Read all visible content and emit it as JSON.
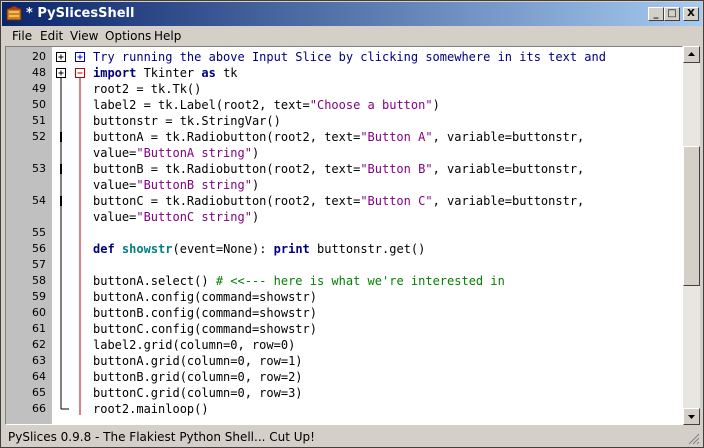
{
  "window": {
    "title": "* PySlicesShell",
    "icon": "pyslices-app-icon"
  },
  "title_buttons": {
    "minimize": "_",
    "maximize": "□",
    "close": "X"
  },
  "menu": [
    "File",
    "Edit",
    "View",
    "Options",
    "Help"
  ],
  "editor": {
    "lines": [
      {
        "num": "20",
        "fold": "plus-both",
        "tokens": [
          {
            "t": "Try running the above Input Slice by clicking somewhere in its text and",
            "c": "kw-plain"
          }
        ]
      },
      {
        "num": "48",
        "fold": "plus-minus",
        "tokens": [
          {
            "t": "import",
            "c": "kw"
          },
          {
            "t": " Tkinter ",
            "c": "plain"
          },
          {
            "t": "as",
            "c": "kw"
          },
          {
            "t": " tk",
            "c": "plain"
          }
        ]
      },
      {
        "num": "49",
        "fold": "",
        "tokens": [
          {
            "t": "root2 = tk.Tk()",
            "c": "plain"
          }
        ]
      },
      {
        "num": "50",
        "fold": "",
        "tokens": [
          {
            "t": "label2 = tk.Label(root2, text=",
            "c": "plain"
          },
          {
            "t": "\"Choose a button\"",
            "c": "str"
          },
          {
            "t": ")",
            "c": "plain"
          }
        ]
      },
      {
        "num": "51",
        "fold": "",
        "tokens": [
          {
            "t": "buttonstr = tk.StringVar()",
            "c": "plain"
          }
        ]
      },
      {
        "num": "52",
        "fold": "",
        "tokens": [
          {
            "t": "buttonA = tk.Radiobutton(root2, text=",
            "c": "plain"
          },
          {
            "t": "\"Button A\"",
            "c": "str"
          },
          {
            "t": ", variable=buttonstr,",
            "c": "plain"
          }
        ]
      },
      {
        "num": "",
        "fold": "",
        "tokens": [
          {
            "t": "value=",
            "c": "plain"
          },
          {
            "t": "\"ButtonA string\"",
            "c": "str"
          },
          {
            "t": ")",
            "c": "plain"
          }
        ]
      },
      {
        "num": "53",
        "fold": "",
        "tokens": [
          {
            "t": "buttonB = tk.Radiobutton(root2, text=",
            "c": "plain"
          },
          {
            "t": "\"Button B\"",
            "c": "str"
          },
          {
            "t": ", variable=buttonstr,",
            "c": "plain"
          }
        ]
      },
      {
        "num": "",
        "fold": "",
        "tokens": [
          {
            "t": "value=",
            "c": "plain"
          },
          {
            "t": "\"ButtonB string\"",
            "c": "str"
          },
          {
            "t": ")",
            "c": "plain"
          }
        ]
      },
      {
        "num": "54",
        "fold": "",
        "tokens": [
          {
            "t": "buttonC = tk.Radiobutton(root2, text=",
            "c": "plain"
          },
          {
            "t": "\"Button C\"",
            "c": "str"
          },
          {
            "t": ", variable=buttonstr,",
            "c": "plain"
          }
        ]
      },
      {
        "num": "",
        "fold": "",
        "tokens": [
          {
            "t": "value=",
            "c": "plain"
          },
          {
            "t": "\"ButtonC string\"",
            "c": "str"
          },
          {
            "t": ")",
            "c": "plain"
          }
        ]
      },
      {
        "num": "55",
        "fold": "",
        "tokens": []
      },
      {
        "num": "56",
        "fold": "",
        "tokens": [
          {
            "t": "def",
            "c": "kw"
          },
          {
            "t": " ",
            "c": "plain"
          },
          {
            "t": "showstr",
            "c": "fn"
          },
          {
            "t": "(event=None): ",
            "c": "plain"
          },
          {
            "t": "print",
            "c": "kw"
          },
          {
            "t": " buttonstr.get()",
            "c": "plain"
          }
        ]
      },
      {
        "num": "57",
        "fold": "",
        "tokens": []
      },
      {
        "num": "58",
        "fold": "",
        "tokens": [
          {
            "t": "buttonA.select() ",
            "c": "plain"
          },
          {
            "t": "# <<--- here is what we're interested in",
            "c": "cmt"
          }
        ]
      },
      {
        "num": "59",
        "fold": "",
        "tokens": [
          {
            "t": "buttonA.config(command=showstr)",
            "c": "plain"
          }
        ]
      },
      {
        "num": "60",
        "fold": "",
        "tokens": [
          {
            "t": "buttonB.config(command=showstr)",
            "c": "plain"
          }
        ]
      },
      {
        "num": "61",
        "fold": "",
        "tokens": [
          {
            "t": "buttonC.config(command=showstr)",
            "c": "plain"
          }
        ]
      },
      {
        "num": "62",
        "fold": "",
        "tokens": [
          {
            "t": "label2.grid(column=0, row=0)",
            "c": "plain"
          }
        ]
      },
      {
        "num": "63",
        "fold": "",
        "tokens": [
          {
            "t": "buttonA.grid(column=0, row=1)",
            "c": "plain"
          }
        ]
      },
      {
        "num": "64",
        "fold": "",
        "tokens": [
          {
            "t": "buttonB.grid(column=0, row=2)",
            "c": "plain"
          }
        ]
      },
      {
        "num": "65",
        "fold": "",
        "tokens": [
          {
            "t": "buttonC.grid(column=0, row=3)",
            "c": "plain"
          }
        ]
      },
      {
        "num": "66",
        "fold": "end",
        "tokens": [
          {
            "t": "root2.mainloop()",
            "c": "plain"
          }
        ]
      }
    ]
  },
  "colors": {
    "keyword": "#00007f",
    "string": "#7f007f",
    "comment": "#007f00",
    "fold_blue": "#0000c0",
    "fold_red": "#c00000",
    "gutter": "#c0c0c0"
  },
  "status": {
    "text": "PySlices 0.9.8 - The Flakiest Python Shell... Cut Up!"
  }
}
